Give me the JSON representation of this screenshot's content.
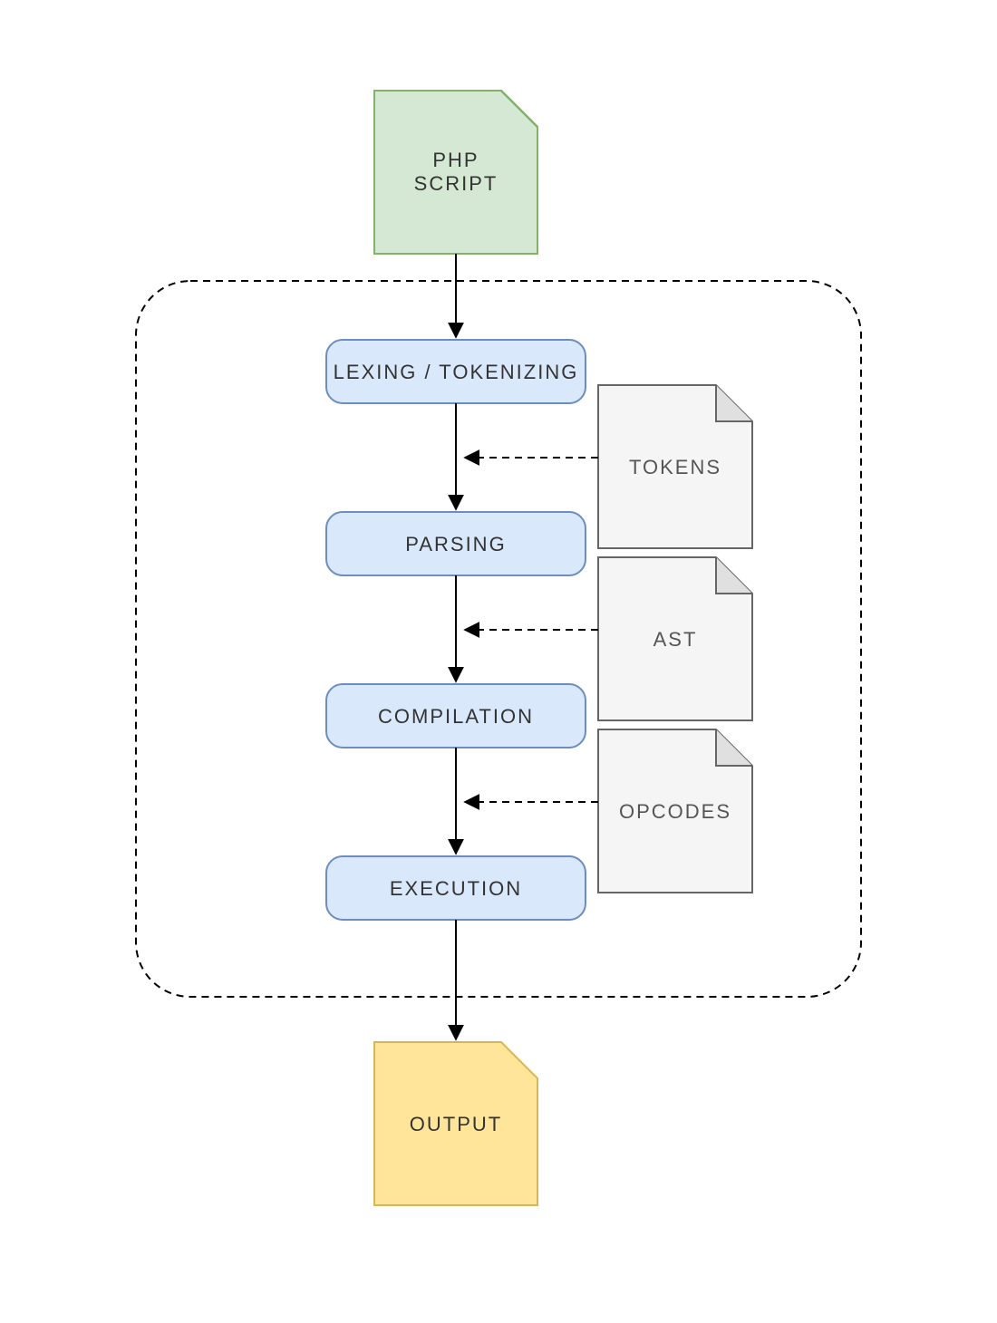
{
  "input": {
    "line1": "PHP",
    "line2": "SCRIPT",
    "fill": "#d5e8d4",
    "stroke": "#82b366"
  },
  "stages": [
    {
      "id": "lexing",
      "label": "LEXING / TOKENIZING"
    },
    {
      "id": "parsing",
      "label": "PARSING"
    },
    {
      "id": "compilation",
      "label": "COMPILATION"
    },
    {
      "id": "execution",
      "label": "EXECUTION"
    }
  ],
  "artifacts": [
    {
      "id": "tokens",
      "label": "TOKENS"
    },
    {
      "id": "ast",
      "label": "AST"
    },
    {
      "id": "opcodes",
      "label": "OPCODES"
    }
  ],
  "output": {
    "label": "OUTPUT",
    "fill": "#ffe599",
    "stroke": "#d6b656"
  },
  "stage_style": {
    "fill": "#dae8fc",
    "stroke": "#6c8ebf"
  },
  "artifact_style": {
    "fill": "#f5f5f5",
    "stroke": "#666666",
    "fold_fill": "#e0e0e0"
  }
}
